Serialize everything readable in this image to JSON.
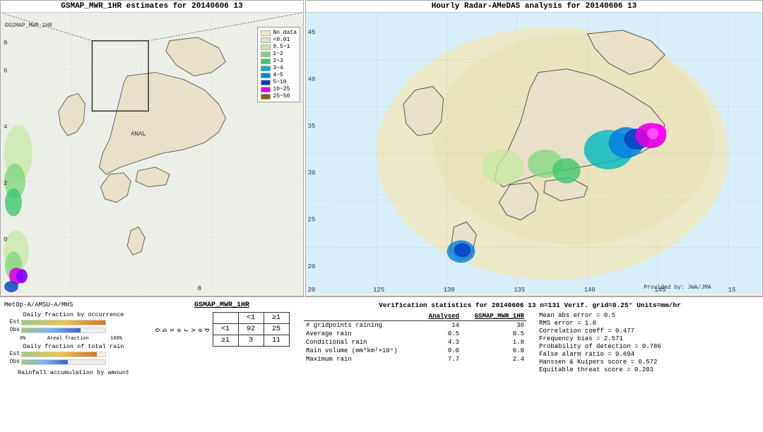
{
  "left_panel": {
    "title": "GSMAP_MWR_1HR estimates for 20140606 13",
    "watermark": "©GSMAP_MWR_1HR",
    "anal_label": "ANAL",
    "y_labels": [
      "8",
      "6",
      "4",
      "2",
      "0"
    ],
    "x_label": "8"
  },
  "right_panel": {
    "title": "Hourly Radar-AMeDAS analysis for 20140606 13",
    "y_labels": [
      "45",
      "40",
      "35",
      "30",
      "25",
      "20"
    ],
    "x_labels": [
      "125",
      "130",
      "135",
      "140",
      "145",
      "15"
    ],
    "x_bottom": "20",
    "credit": "Provided by: JWA/JMA"
  },
  "legend": {
    "items": [
      {
        "label": "No data",
        "color": "#f0e8c8"
      },
      {
        "label": "<0.01",
        "color": "#e8e0b8"
      },
      {
        "label": "0.5~1",
        "color": "#c8e8a0"
      },
      {
        "label": "1~2",
        "color": "#80d880"
      },
      {
        "label": "2~3",
        "color": "#40c870"
      },
      {
        "label": "3~4",
        "color": "#00b8c0"
      },
      {
        "label": "4~5",
        "color": "#0080e0"
      },
      {
        "label": "5~10",
        "color": "#0040c0"
      },
      {
        "label": "10~25",
        "color": "#e000e0"
      },
      {
        "label": "25~50",
        "color": "#806000"
      }
    ]
  },
  "bottom": {
    "satellite": "MetOp-A/AMSU-A/MHS",
    "chart1_title": "Daily fraction by occurrence",
    "chart2_title": "Daily fraction of total rain",
    "chart3_title": "Rainfall accumulation by amount",
    "bar_labels": {
      "est": "Est",
      "obs": "Obs"
    },
    "axis_start": "0%",
    "axis_end": "100%",
    "axis_mid": "Areal fraction"
  },
  "contingency": {
    "gsmap_label": "GSMAP_MWR_1HR",
    "col_headers": [
      "<1",
      "≥1"
    ],
    "row_header_label": "O\nb\ns\ne\nr\nv\ne\nd",
    "row_lt1": "<1",
    "row_ge1": "≥1",
    "cells": {
      "a": "92",
      "b": "25",
      "c": "3",
      "d": "11"
    }
  },
  "verification": {
    "title": "Verification statistics for 20140606 13  n=131  Verif. grid=0.25°  Units=mm/hr",
    "table_headers": [
      "Analysed",
      "GSMAP_MWR_1HR"
    ],
    "rows": [
      {
        "name": "# gridpoints raining",
        "analysed": "14",
        "gsmap": "36"
      },
      {
        "name": "Average rain",
        "analysed": "0.5",
        "gsmap": "0.5"
      },
      {
        "name": "Conditional rain",
        "analysed": "4.3",
        "gsmap": "1.8"
      },
      {
        "name": "Rain volume (mm*km²×10⁶)",
        "analysed": "0.0",
        "gsmap": "0.0"
      },
      {
        "name": "Maximum rain",
        "analysed": "7.7",
        "gsmap": "2.4"
      }
    ],
    "right_stats": [
      "Mean abs error = 0.5",
      "RMS error = 1.0",
      "Correlation coeff = 0.477",
      "Frequency bias = 2.571",
      "Probability of detection = 0.786",
      "False alarm ratio = 0.694",
      "Hanssen & Kuipers score = 0.572",
      "Equitable threat score = 0.203"
    ]
  }
}
